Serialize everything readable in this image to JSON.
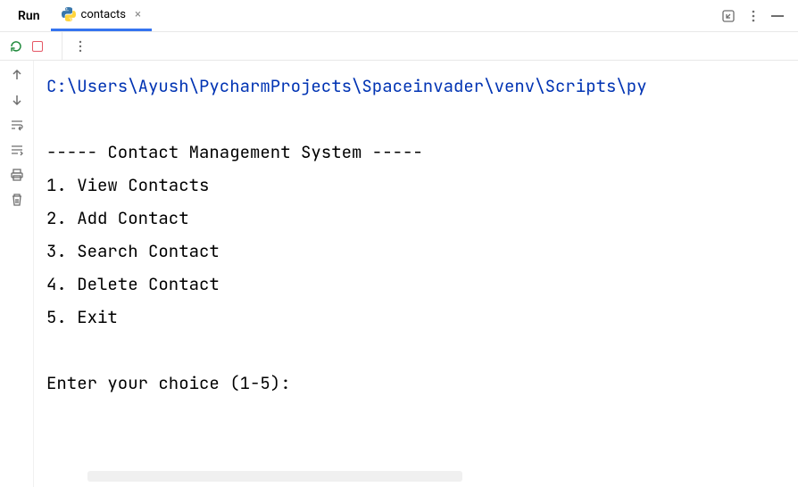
{
  "header": {
    "run_label": "Run",
    "tab_label": "contacts"
  },
  "console": {
    "path": "C:\\Users\\Ayush\\PycharmProjects\\Spaceinvader\\venv\\Scripts\\py",
    "lines": [
      "",
      "----- Contact Management System -----",
      "1. View Contacts",
      "2. Add Contact",
      "3. Search Contact",
      "4. Delete Contact",
      "5. Exit",
      "",
      "Enter your choice (1-5): "
    ]
  }
}
